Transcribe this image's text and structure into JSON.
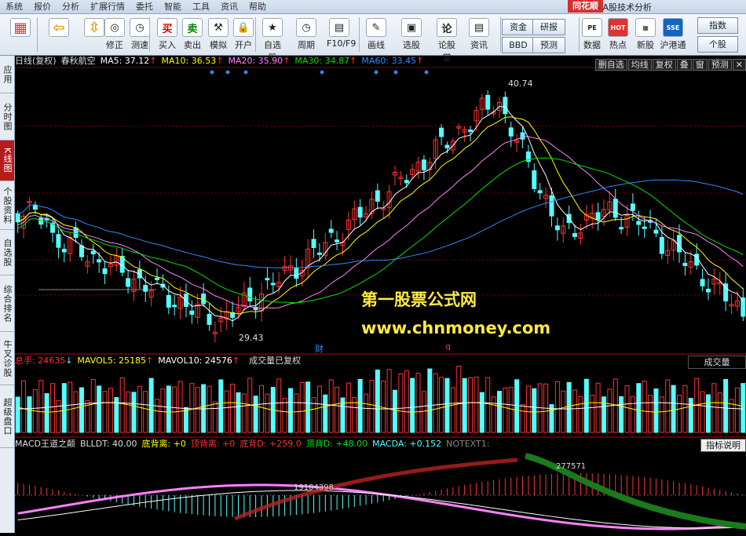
{
  "menu": {
    "items": [
      "系统",
      "报价",
      "分析",
      "扩展行情",
      "委托",
      "智能",
      "工具",
      "资讯",
      "帮助"
    ],
    "brand": "同花顺",
    "app_title": "- A股技术分析"
  },
  "toolbar": {
    "buttons": [
      {
        "label": "",
        "icon": "grid-icon"
      },
      {
        "label": "",
        "icon": "back-arrow-icon"
      },
      {
        "label": "",
        "icon": "up-down-arrow-icon"
      },
      {
        "label": "修正",
        "icon": "correct-icon"
      },
      {
        "label": "测速",
        "icon": "speed-icon"
      },
      {
        "label": "买入",
        "icon": "buy-icon",
        "glyph": "买"
      },
      {
        "label": "卖出",
        "icon": "sell-icon",
        "glyph": "卖"
      },
      {
        "label": "模拟",
        "icon": "simulate-icon"
      },
      {
        "label": "开户",
        "icon": "lock-icon"
      },
      {
        "label": "自选股",
        "icon": "star-icon"
      },
      {
        "label": "周期",
        "icon": "clock-icon"
      },
      {
        "label": "F10/F9",
        "icon": "f10-icon"
      },
      {
        "label": "画线",
        "icon": "pen-icon"
      },
      {
        "label": "选股",
        "icon": "select-stock-icon"
      },
      {
        "label": "论股堂",
        "icon": "forum-icon"
      },
      {
        "label": "资讯",
        "icon": "news-icon"
      }
    ],
    "right_buttons": [
      "资金",
      "研报",
      "BBD",
      "预测"
    ],
    "right_icons": [
      {
        "label": "数据",
        "icon": "pe-icon",
        "glyph": "PE"
      },
      {
        "label": "热点",
        "icon": "hot-icon",
        "glyph": "HOT"
      },
      {
        "label": "新股",
        "icon": "new-stock-icon"
      },
      {
        "label": "沪港通",
        "icon": "sse-hkex-icon",
        "glyph": "SSE"
      }
    ],
    "index_btn": "指数",
    "stock_btn": "个股"
  },
  "left_nav": [
    "应用",
    "分时图",
    "K线图",
    "个股资料",
    "自选股",
    "综合排名",
    "牛叉诊股",
    "超级盘口"
  ],
  "kline_header": {
    "mode": "日线(复权)",
    "stock": "春秋航空",
    "ma5": "MA5: 37.12",
    "ma10": "MA10: 36.53",
    "ma20": "MA20: 35.90",
    "ma30": "MA30: 34.87",
    "ma60": "MA60: 33.45",
    "buttons": [
      "删自选",
      "均线",
      "复权",
      "叠",
      "窗",
      "预测"
    ]
  },
  "price_labels": {
    "high": "40.74",
    "low": "29.43",
    "cai": "财",
    "q": "q"
  },
  "volume_header": {
    "total": "总手: 24635",
    "mavol5": "MAVOL5: 25185",
    "mavol10": "MAVOL10: 24576",
    "note": "成交量已复权",
    "title_btn": "成交量"
  },
  "macd_header": {
    "name": "MACD王道之颠",
    "blldt": "BLLDT: 40.00",
    "dbl": "底背离: +0",
    "dingbl": "顶背离: +0",
    "dibeid": "底背D: +259.0",
    "dingbeid": "顶背D: +48.00",
    "macda": "MACDA: +0.152",
    "notext": "NOTEXT1:",
    "help_btn": "指标说明",
    "val1": "19184398",
    "val2": "277571"
  },
  "watermark": {
    "line1": "第一股票公式网",
    "line2": "www.chnmoney.com"
  },
  "colors": {
    "up": "#ff3232",
    "down": "#54ffff",
    "ma5": "#ffffff",
    "ma10": "#ffff00",
    "ma20": "#ff80ff",
    "ma30": "#00e000",
    "ma60": "#2e8bff"
  }
}
